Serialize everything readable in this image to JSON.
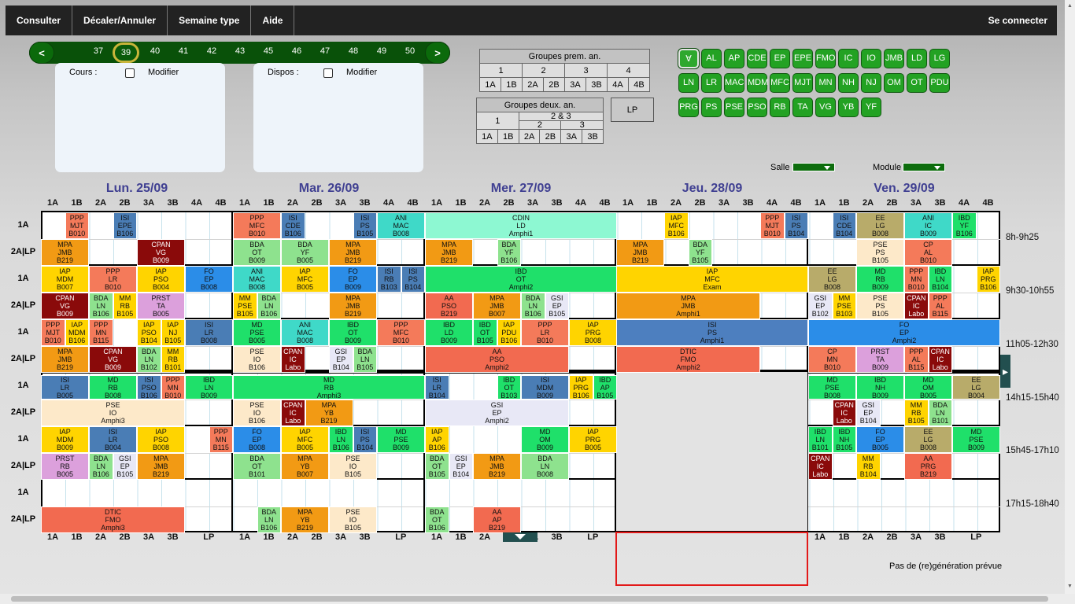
{
  "nav": {
    "items": [
      "Consulter",
      "Décaler/Annuler",
      "Semaine type",
      "Aide"
    ],
    "login": "Se connecter"
  },
  "weeks": {
    "prev": "<",
    "next": ">",
    "numbers": [
      "37",
      "38",
      "39",
      "40",
      "41",
      "42",
      "43",
      "45",
      "46",
      "47",
      "48",
      "49",
      "50"
    ],
    "selected": "39"
  },
  "panels": {
    "cours": "Cours :",
    "dispos": "Dispos :",
    "modifier": "Modifier"
  },
  "groups1": {
    "title": "Groupes prem. an.",
    "row1": [
      "1",
      "2",
      "3",
      "4"
    ],
    "row2": [
      "1A",
      "1B",
      "2A",
      "2B",
      "3A",
      "3B",
      "4A",
      "4B"
    ]
  },
  "groups2": {
    "title": "Groupes deux. an.",
    "one": "1",
    "twothree": "2 & 3",
    "two": "2",
    "three": "3",
    "row": [
      "1A",
      "1B",
      "2A",
      "2B",
      "3A",
      "3B"
    ]
  },
  "lp_button": "LP",
  "people": [
    "∀",
    "AL",
    "AP",
    "CDE",
    "EP",
    "EPE",
    "FMO",
    "IC",
    "IO",
    "JMB",
    "LD",
    "LG",
    "LN",
    "LR",
    "MAC",
    "MDM",
    "MFC",
    "MJT",
    "MN",
    "NH",
    "NJ",
    "OM",
    "OT",
    "PDU",
    "PRG",
    "PS",
    "PSE",
    "PSO",
    "RB",
    "TA",
    "VG",
    "YB",
    "YF"
  ],
  "filters": {
    "salle": "Salle",
    "module": "Module"
  },
  "days": [
    "Lun. 25/09",
    "Mar. 26/09",
    "Mer. 27/09",
    "Jeu. 28/09",
    "Ven. 29/09"
  ],
  "columns": [
    "1A",
    "1B",
    "2A",
    "2B",
    "3A",
    "3B",
    "4A",
    "4B"
  ],
  "bottom_columns": [
    "1A",
    "1B",
    "2A",
    "2B",
    "3A",
    "3B",
    "LP"
  ],
  "row_labels": [
    "1A",
    "2A|LP"
  ],
  "times": [
    "8h-9h25",
    "9h30-10h55",
    "11h05-12h30",
    "14h15-15h40",
    "15h45-17h10",
    "17h15-18h40"
  ],
  "status": "Pas de (re)génération prévue",
  "colors": {
    "MPA": "#f29a14",
    "PPP": "#f47a5a",
    "ISI": "#4a7db5",
    "CPAN": "#8a0a0a",
    "BDA": "#8ee28e",
    "IAP": "#ffd400",
    "FO": "#2b8de8",
    "MD": "#1fe06a",
    "IBD": "#1fe06a",
    "ANI": "#3fd9c8",
    "EE": "#b8ab6a",
    "PSE": "#fde9c9",
    "PRST": "#dca0dc",
    "MM": "#ffd400",
    "GSI": "#e8e8f6",
    "DTIC": "#f26a50",
    "CDIN": "#8df8d2",
    "AA": "#f26a50",
    "CP": "#f47a5a"
  },
  "courses": [
    {
      "id": 0,
      "l": [
        "PPP",
        "MJT",
        "B010"
      ]
    },
    {
      "id": 1,
      "l": [
        "ISI",
        "EPE",
        "B106"
      ]
    },
    {
      "id": 2,
      "l": [
        "MPA",
        "JMB",
        "B219"
      ]
    },
    {
      "id": 3,
      "l": [
        "CPAN",
        "VG",
        "B009"
      ]
    },
    {
      "id": 4,
      "l": [
        "PPP",
        "MFC",
        "B010"
      ]
    },
    {
      "id": 5,
      "l": [
        "ISI",
        "CDE",
        "B106"
      ]
    },
    {
      "id": 6,
      "l": [
        "ISI",
        "PS",
        "B105"
      ]
    },
    {
      "id": 7,
      "l": [
        "ANI",
        "MAC",
        "B008"
      ]
    },
    {
      "id": 8,
      "l": [
        "BDA",
        "OT",
        "B009"
      ]
    },
    {
      "id": 9,
      "l": [
        "BDA",
        "YF",
        "B005"
      ]
    },
    {
      "id": 10,
      "l": [
        "MPA",
        "JMB",
        "B219"
      ]
    },
    {
      "id": 11,
      "l": [
        "CDIN",
        "LD",
        "Amphi1"
      ]
    },
    {
      "id": 12,
      "l": [
        "MPA",
        "JMB",
        "B219"
      ]
    },
    {
      "id": 13,
      "l": [
        "BDA",
        "YF",
        "B106"
      ]
    },
    {
      "id": 14,
      "l": [
        "IAP",
        "MFC",
        "B106"
      ]
    },
    {
      "id": 15,
      "l": [
        "PPP",
        "MJT",
        "B010"
      ]
    },
    {
      "id": 16,
      "l": [
        "ISI",
        "PS",
        "B104"
      ]
    },
    {
      "id": 17,
      "l": [
        "MPA",
        "JMB",
        "B219"
      ]
    },
    {
      "id": 18,
      "l": [
        "BDA",
        "YF",
        "B105"
      ]
    },
    {
      "id": 19,
      "l": [
        "ISI",
        "CDE",
        "B104"
      ]
    },
    {
      "id": 20,
      "l": [
        "EE",
        "LG",
        "B008"
      ]
    },
    {
      "id": 21,
      "l": [
        "ANI",
        "IC",
        "B009"
      ]
    },
    {
      "id": 22,
      "l": [
        "IBD",
        "YF",
        "B106"
      ]
    },
    {
      "id": 23,
      "l": [
        "PSE",
        "PS",
        "B105"
      ]
    },
    {
      "id": 24,
      "l": [
        "CP",
        "AL",
        "B010"
      ]
    },
    {
      "id": 25,
      "l": [
        "IAP",
        "MDM",
        "B007"
      ]
    },
    {
      "id": 26,
      "l": [
        "PPP",
        "LR",
        "B010"
      ]
    },
    {
      "id": 27,
      "l": [
        "IAP",
        "PSO",
        "B004"
      ]
    },
    {
      "id": 28,
      "l": [
        "FO",
        "EP",
        "B008"
      ]
    },
    {
      "id": 29,
      "l": [
        "CPAN",
        "VG",
        "B009"
      ]
    },
    {
      "id": 30,
      "l": [
        "BDA",
        "LN",
        "B106"
      ]
    },
    {
      "id": 31,
      "l": [
        "MM",
        "RB",
        "B105"
      ]
    },
    {
      "id": 32,
      "l": [
        "PRST",
        "TA",
        "B005"
      ]
    },
    {
      "id": 33,
      "l": [
        "ANI",
        "MAC",
        "B008"
      ]
    },
    {
      "id": 34,
      "l": [
        "IAP",
        "MFC",
        "B005"
      ]
    },
    {
      "id": 35,
      "l": [
        "FO",
        "EP",
        "B009"
      ]
    },
    {
      "id": 36,
      "l": [
        "ISI",
        "RB",
        "B103"
      ]
    },
    {
      "id": 37,
      "l": [
        "ISI",
        "PS",
        "B104"
      ]
    },
    {
      "id": 38,
      "l": [
        "MM",
        "PSE",
        "B105"
      ]
    },
    {
      "id": 39,
      "l": [
        "BDA",
        "LN",
        "B106"
      ]
    },
    {
      "id": 40,
      "l": [
        "MPA",
        "JMB",
        "B219"
      ]
    },
    {
      "id": 41,
      "l": [
        "IBD",
        "OT",
        "Amphi2"
      ]
    },
    {
      "id": 42,
      "l": [
        "AA",
        "PSO",
        "B219"
      ]
    },
    {
      "id": 43,
      "l": [
        "MPA",
        "JMB",
        "B007"
      ]
    },
    {
      "id": 44,
      "l": [
        "BDA",
        "LN",
        "B106"
      ]
    },
    {
      "id": 45,
      "l": [
        "GSI",
        "EP",
        "B105"
      ]
    },
    {
      "id": 46,
      "l": [
        "IAP",
        "MFC",
        "Exam"
      ]
    },
    {
      "id": 47,
      "l": [
        "MPA",
        "JMB",
        "Amphi1"
      ]
    },
    {
      "id": 48,
      "l": [
        "EE",
        "LG",
        "B008"
      ]
    },
    {
      "id": 49,
      "l": [
        "MD",
        "RB",
        "B009"
      ]
    },
    {
      "id": 50,
      "l": [
        "PPP",
        "MN",
        "B010"
      ]
    },
    {
      "id": 51,
      "l": [
        "IBD",
        "LN",
        "B104"
      ]
    },
    {
      "id": 52,
      "l": [
        "IAP",
        "PRG",
        "B106"
      ]
    },
    {
      "id": 53,
      "l": [
        "GSI",
        "EP",
        "B102"
      ]
    },
    {
      "id": 54,
      "l": [
        "MM",
        "PSE",
        "B103"
      ]
    },
    {
      "id": 55,
      "l": [
        "PSE",
        "PS",
        "B105"
      ]
    },
    {
      "id": 56,
      "l": [
        "CPAN",
        "IC",
        "Labo"
      ]
    },
    {
      "id": 57,
      "l": [
        "PPP",
        "AL",
        "B115"
      ]
    },
    {
      "id": 58,
      "l": [
        "PPP",
        "MJT",
        "B010"
      ]
    },
    {
      "id": 59,
      "l": [
        "IAP",
        "MDM",
        "B106"
      ]
    },
    {
      "id": 60,
      "l": [
        "PPP",
        "MN",
        "B115"
      ]
    },
    {
      "id": 61,
      "l": [
        "IAP",
        "PSO",
        "B104"
      ]
    },
    {
      "id": 62,
      "l": [
        "IAP",
        "NJ",
        "B105"
      ]
    },
    {
      "id": 63,
      "l": [
        "ISI",
        "LR",
        "B008"
      ]
    },
    {
      "id": 64,
      "l": [
        "MPA",
        "JMB",
        "B219"
      ]
    },
    {
      "id": 65,
      "l": [
        "CPAN",
        "VG",
        "B009"
      ]
    },
    {
      "id": 66,
      "l": [
        "BDA",
        "LN",
        "B102"
      ]
    },
    {
      "id": 67,
      "l": [
        "MM",
        "RB",
        "B101"
      ]
    },
    {
      "id": 68,
      "l": [
        "MD",
        "PSE",
        "B005"
      ]
    },
    {
      "id": 69,
      "l": [
        "ANI",
        "MAC",
        "B008"
      ]
    },
    {
      "id": 70,
      "l": [
        "IBD",
        "OT",
        "B009"
      ]
    },
    {
      "id": 71,
      "l": [
        "PPP",
        "MFC",
        "B010"
      ]
    },
    {
      "id": 72,
      "l": [
        "PSE",
        "IO",
        "B106"
      ]
    },
    {
      "id": 73,
      "l": [
        "CPAN",
        "IC",
        "Labo"
      ]
    },
    {
      "id": 74,
      "l": [
        "GSI",
        "EP",
        "B104"
      ]
    },
    {
      "id": 75,
      "l": [
        "BDA",
        "LN",
        "B105"
      ]
    },
    {
      "id": 76,
      "l": [
        "IBD",
        "LD",
        "B009"
      ]
    },
    {
      "id": 77,
      "l": [
        "IBD",
        "OT",
        "B105"
      ]
    },
    {
      "id": 78,
      "l": [
        "IAP",
        "PDU",
        "B106"
      ]
    },
    {
      "id": 79,
      "l": [
        "PPP",
        "LR",
        "B010"
      ]
    },
    {
      "id": 80,
      "l": [
        "IAP",
        "PRG",
        "B008"
      ]
    },
    {
      "id": 81,
      "l": [
        "AA",
        "PSO",
        "Amphi2"
      ]
    },
    {
      "id": 82,
      "l": [
        "ISI",
        "PS",
        "Amphi1"
      ]
    },
    {
      "id": 83,
      "l": [
        "DTIC",
        "FMO",
        "Amphi2"
      ]
    },
    {
      "id": 84,
      "l": [
        "FO",
        "EP",
        "Amphi2"
      ]
    },
    {
      "id": 85,
      "l": [
        "CP",
        "MN",
        "B010"
      ]
    },
    {
      "id": 86,
      "l": [
        "PRST",
        "TA",
        "B009"
      ]
    },
    {
      "id": 87,
      "l": [
        "PPP",
        "AL",
        "B115"
      ]
    },
    {
      "id": 88,
      "l": [
        "CPAN",
        "IC",
        "Labo"
      ]
    },
    {
      "id": 89,
      "l": [
        "ISI",
        "LR",
        "B005"
      ]
    },
    {
      "id": 90,
      "l": [
        "MD",
        "RB",
        "B008"
      ]
    },
    {
      "id": 91,
      "l": [
        "ISI",
        "PSO",
        "B106"
      ]
    },
    {
      "id": 92,
      "l": [
        "PPP",
        "MN",
        "B010"
      ]
    },
    {
      "id": 93,
      "l": [
        "IBD",
        "LN",
        "B009"
      ]
    },
    {
      "id": 94,
      "l": [
        "PSE",
        "IO",
        "Amphi3"
      ]
    },
    {
      "id": 95,
      "l": [
        "MD",
        "RB",
        "Amphi3"
      ]
    },
    {
      "id": 96,
      "l": [
        "PSE",
        "IO",
        "B106"
      ]
    },
    {
      "id": 97,
      "l": [
        "CPAN",
        "IC",
        "Labo"
      ]
    },
    {
      "id": 98,
      "l": [
        "MPA",
        "YB",
        "B219"
      ]
    },
    {
      "id": 99,
      "l": [
        "ISI",
        "LR",
        "B104"
      ]
    },
    {
      "id": 100,
      "l": [
        "IBD",
        "OT",
        "B103"
      ]
    },
    {
      "id": 101,
      "l": [
        "ISI",
        "MDM",
        "B009"
      ]
    },
    {
      "id": 102,
      "l": [
        "IAP",
        "PRG",
        "B106"
      ]
    },
    {
      "id": 103,
      "l": [
        "IBD",
        "AP",
        "B105"
      ]
    },
    {
      "id": 104,
      "l": [
        "GSI",
        "EP",
        "Amphi2"
      ]
    },
    {
      "id": 105,
      "l": [
        "MD",
        "PSE",
        "B008"
      ]
    },
    {
      "id": 106,
      "l": [
        "IBD",
        "NH",
        "B009"
      ]
    },
    {
      "id": 107,
      "l": [
        "MD",
        "OM",
        "B005"
      ]
    },
    {
      "id": 108,
      "l": [
        "EE",
        "LG",
        "B004"
      ]
    },
    {
      "id": 109,
      "l": [
        "CPAN",
        "IC",
        "Labo"
      ]
    },
    {
      "id": 110,
      "l": [
        "GSI",
        "EP",
        "B104"
      ]
    },
    {
      "id": 111,
      "l": [
        "MM",
        "RB",
        "B105"
      ]
    },
    {
      "id": 112,
      "l": [
        "BDA",
        "LN",
        "B101"
      ]
    },
    {
      "id": 113,
      "l": [
        "IAP",
        "MDM",
        "B009"
      ]
    },
    {
      "id": 114,
      "l": [
        "ISI",
        "LR",
        "B004"
      ]
    },
    {
      "id": 115,
      "l": [
        "IAP",
        "PSO",
        "B008"
      ]
    },
    {
      "id": 116,
      "l": [
        "PPP",
        "MN",
        "B115"
      ]
    },
    {
      "id": 117,
      "l": [
        "PRST",
        "RB",
        "B005"
      ]
    },
    {
      "id": 118,
      "l": [
        "BDA",
        "LN",
        "B106"
      ]
    },
    {
      "id": 119,
      "l": [
        "GSI",
        "EP",
        "B105"
      ]
    },
    {
      "id": 120,
      "l": [
        "MPA",
        "JMB",
        "B219"
      ]
    },
    {
      "id": 121,
      "l": [
        "FO",
        "EP",
        "B008"
      ]
    },
    {
      "id": 122,
      "l": [
        "IAP",
        "MFC",
        "B005"
      ]
    },
    {
      "id": 123,
      "l": [
        "IBD",
        "LN",
        "B106"
      ]
    },
    {
      "id": 124,
      "l": [
        "ISI",
        "PS",
        "B104"
      ]
    },
    {
      "id": 125,
      "l": [
        "MD",
        "PSE",
        "B009"
      ]
    },
    {
      "id": 126,
      "l": [
        "BDA",
        "OT",
        "B101"
      ]
    },
    {
      "id": 127,
      "l": [
        "MPA",
        "YB",
        "B007"
      ]
    },
    {
      "id": 128,
      "l": [
        "PSE",
        "IO",
        "B105"
      ]
    },
    {
      "id": 129,
      "l": [
        "IAP",
        "AP",
        "B106"
      ]
    },
    {
      "id": 130,
      "l": [
        "MD",
        "OM",
        "B009"
      ]
    },
    {
      "id": 131,
      "l": [
        "IAP",
        "PRG",
        "B005"
      ]
    },
    {
      "id": 132,
      "l": [
        "BDA",
        "OT",
        "B105"
      ]
    },
    {
      "id": 133,
      "l": [
        "GSI",
        "EP",
        "B104"
      ]
    },
    {
      "id": 134,
      "l": [
        "MPA",
        "JMB",
        "B219"
      ]
    },
    {
      "id": 135,
      "l": [
        "BDA",
        "LN",
        "B008"
      ]
    },
    {
      "id": 136,
      "l": [
        "IBD",
        "LN",
        "B101"
      ]
    },
    {
      "id": 137,
      "l": [
        "IBD",
        "NH",
        "B105"
      ]
    },
    {
      "id": 138,
      "l": [
        "FO",
        "EP",
        "B005"
      ]
    },
    {
      "id": 139,
      "l": [
        "EE",
        "LG",
        "B008"
      ]
    },
    {
      "id": 140,
      "l": [
        "MD",
        "PSE",
        "B009"
      ]
    },
    {
      "id": 141,
      "l": [
        "CPAN",
        "IC",
        "Labo"
      ]
    },
    {
      "id": 142,
      "l": [
        "MM",
        "RB",
        "B104"
      ]
    },
    {
      "id": 143,
      "l": [
        "AA",
        "PRG",
        "B219"
      ]
    },
    {
      "id": 144,
      "l": [
        "DTIC",
        "FMO",
        "Amphi3"
      ]
    },
    {
      "id": 145,
      "l": [
        "BDA",
        "LN",
        "B106"
      ]
    },
    {
      "id": 146,
      "l": [
        "MPA",
        "YB",
        "B219"
      ]
    },
    {
      "id": 147,
      "l": [
        "PSE",
        "IO",
        "B105"
      ]
    },
    {
      "id": 148,
      "l": [
        "BDA",
        "OT",
        "B106"
      ]
    },
    {
      "id": 149,
      "l": [
        "AA",
        "AP",
        "B219"
      ]
    }
  ]
}
